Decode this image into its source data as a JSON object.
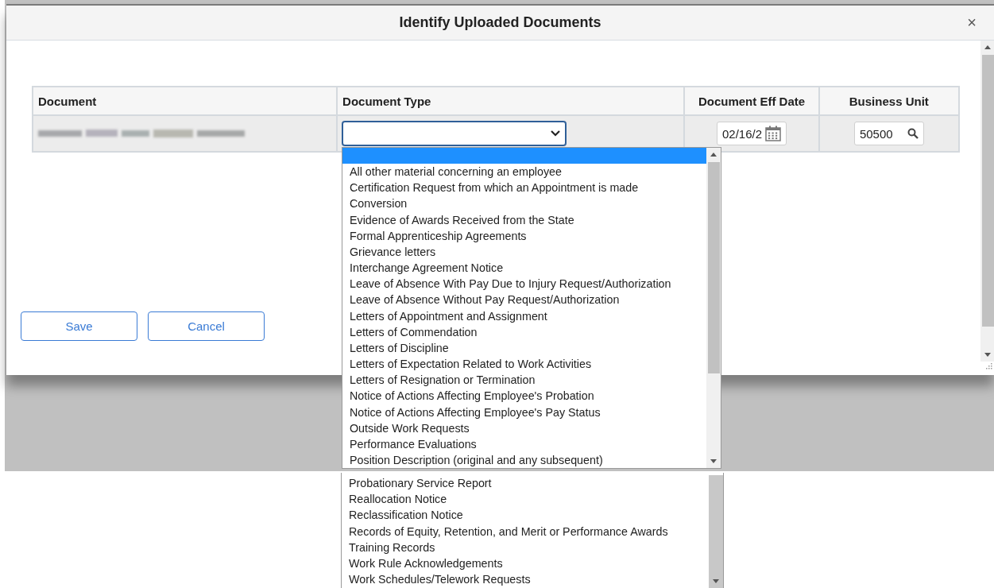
{
  "dialog": {
    "title": "Identify Uploaded Documents",
    "close": "×"
  },
  "table": {
    "columns": [
      "Document",
      "Document Type",
      "Document Eff Date",
      "Business Unit"
    ],
    "rows": [
      {
        "document_type": {
          "expanded": true
        },
        "eff_date": "02/16/2",
        "business_unit": "50500"
      }
    ]
  },
  "buttons": [
    "Save",
    "Cancel"
  ],
  "dropdown_options": [
    {
      "selected": true
    },
    {
      "label": "All other material concerning an employee",
      "selected": false
    },
    {
      "label": "Certification Request from which an Appointment is made",
      "selected": false
    },
    {
      "label": "Conversion",
      "selected": false
    },
    {
      "label": "Evidence of Awards Received from the State",
      "selected": false
    },
    {
      "label": "Formal Apprenticeship Agreements",
      "selected": false
    },
    {
      "label": "Grievance letters",
      "selected": false
    },
    {
      "label": "Interchange Agreement Notice",
      "selected": false
    },
    {
      "label": "Leave of Absence With Pay Due to Injury Request/Authorization",
      "selected": false
    },
    {
      "label": "Leave of Absence Without Pay Request/Authorization",
      "selected": false
    },
    {
      "label": "Letters of Appointment and Assignment",
      "selected": false
    },
    {
      "label": "Letters of Commendation",
      "selected": false
    },
    {
      "label": "Letters of Discipline",
      "selected": false
    },
    {
      "label": "Letters of Expectation Related to Work Activities",
      "selected": false
    },
    {
      "label": "Letters of Resignation or Termination",
      "selected": false
    },
    {
      "label": "Notice of Actions Affecting Employee's Probation",
      "selected": false
    },
    {
      "label": "Notice of Actions Affecting Employee's Pay Status",
      "selected": false
    },
    {
      "label": "Outside Work Requests",
      "selected": false
    },
    {
      "label": "Performance Evaluations",
      "selected": false
    },
    {
      "label": "Position Description (original and any subsequent)",
      "selected": false
    }
  ],
  "dropdown_continuation": [
    {
      "label": "Probationary Service Report",
      "selected": false
    },
    {
      "label": "Reallocation Notice",
      "selected": false
    },
    {
      "label": "Reclassification Notice",
      "selected": false
    },
    {
      "label": "Records of Equity, Retention, and Merit or Performance Awards",
      "selected": false
    },
    {
      "label": "Training Records",
      "selected": false
    },
    {
      "label": "Work Rule Acknowledgements",
      "selected": false
    },
    {
      "label": "Work Schedules/Telework Requests",
      "selected": false
    }
  ]
}
